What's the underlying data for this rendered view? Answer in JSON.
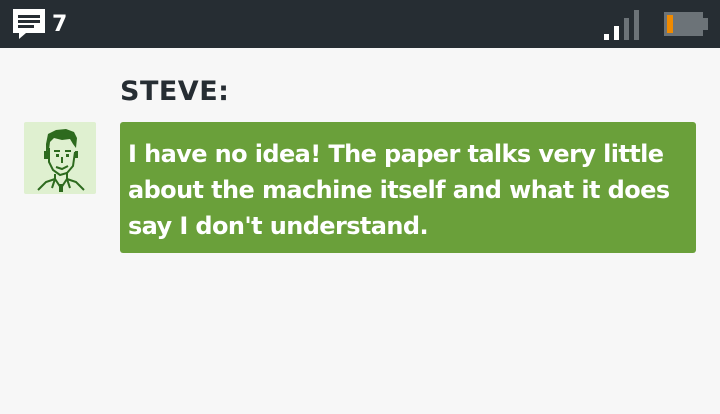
{
  "status_bar": {
    "message_count": "7",
    "colors": {
      "background": "#262d33",
      "battery_level": "#f08a00"
    },
    "signal_icon": "signal-strength-icon",
    "battery_icon": "battery-low-icon",
    "message_icon": "chat-bubble-icon"
  },
  "dialogue": {
    "speaker": "STEVE:",
    "text": "I have no idea! The paper talks very little about the machine itself and what it does say I don't understand.",
    "portrait_icon": "steve-portrait",
    "colors": {
      "bubble": "#6aa03a",
      "text": "#ffffff"
    }
  }
}
